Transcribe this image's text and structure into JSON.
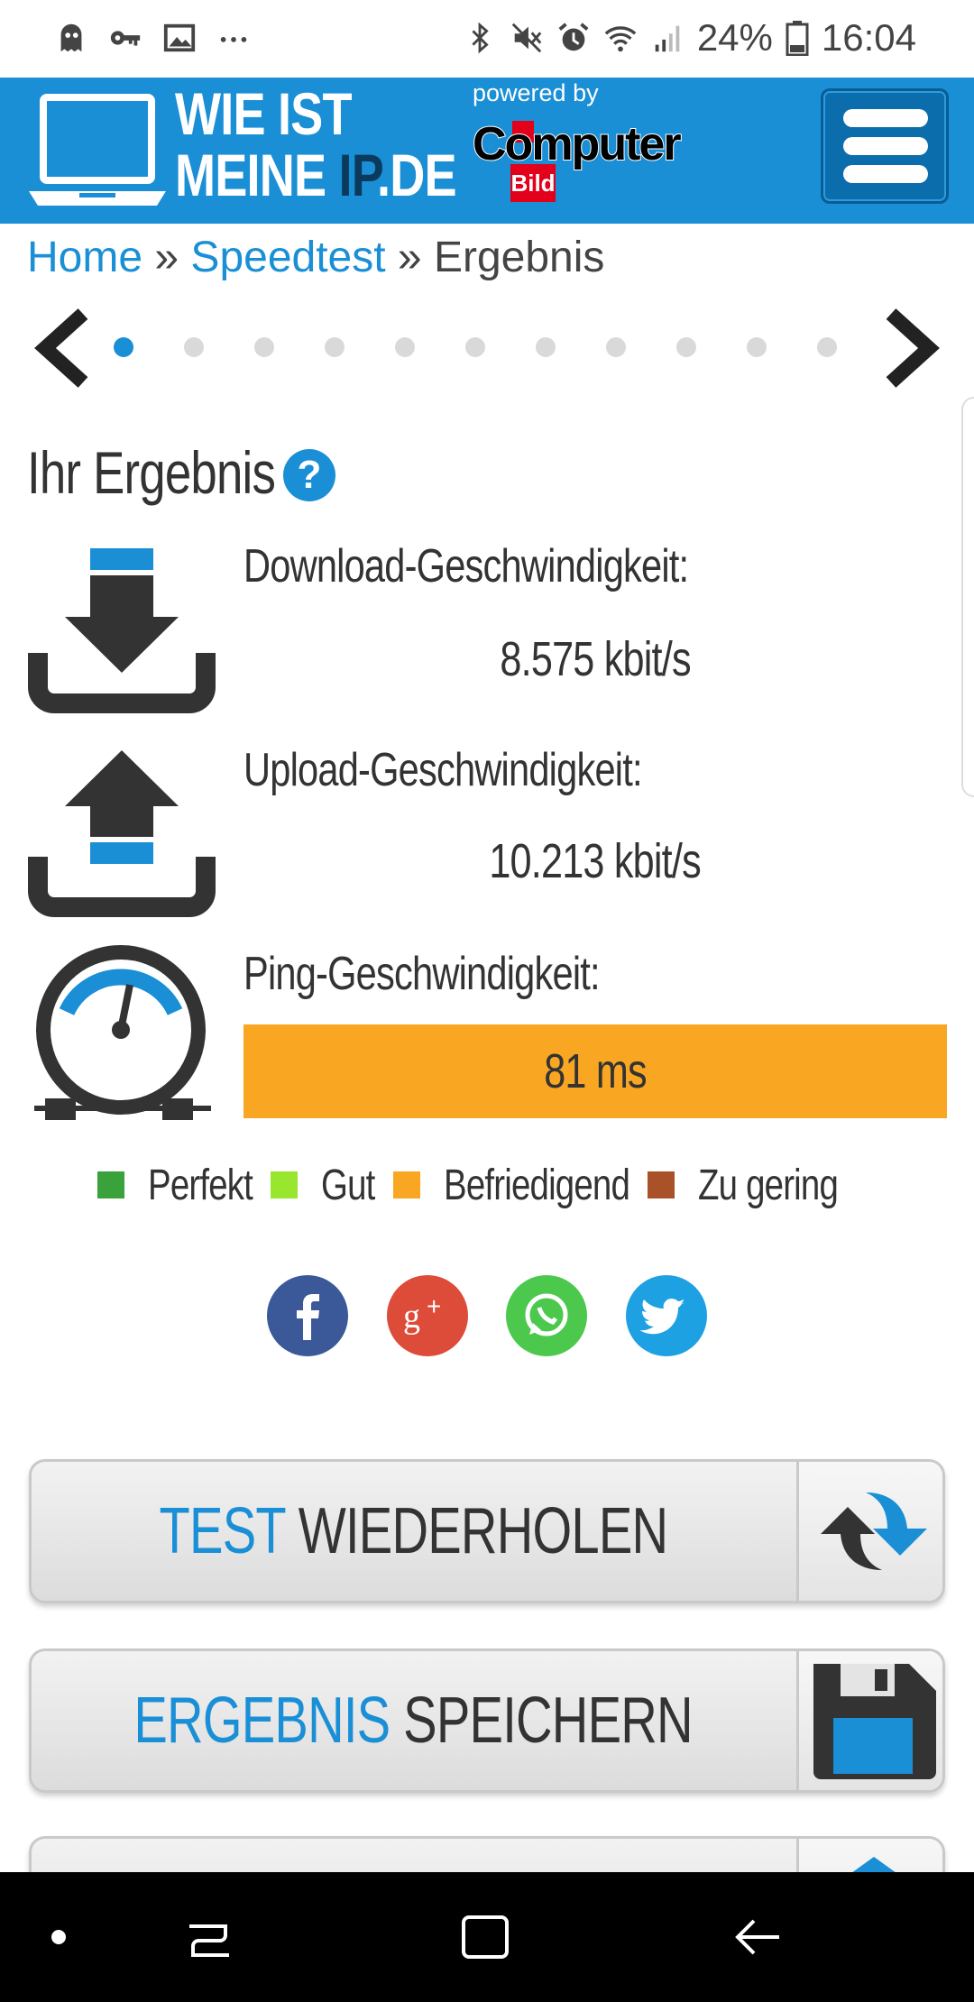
{
  "status_bar": {
    "left_icons": [
      "ghost-icon",
      "key-icon",
      "image-icon",
      "more-icon"
    ],
    "right_icons": [
      "bluetooth-icon",
      "mute-icon",
      "alarm-icon",
      "wifi-icon",
      "signal-icon"
    ],
    "battery": "24%",
    "time": "16:04"
  },
  "header": {
    "logo_line1": "WIE IST",
    "logo_line2_a": "MEINE ",
    "logo_line2_b": "IP",
    "logo_line2_c": ".DE",
    "powered_by": "powered by",
    "partner_name": "Computer",
    "partner_sub": "Bild"
  },
  "breadcrumb": {
    "home": "Home",
    "sep1": " » ",
    "speedtest": "Speedtest",
    "sep2": " » ",
    "current": "Ergebnis"
  },
  "carousel": {
    "dot_count": 11,
    "active_index": 0
  },
  "result": {
    "title": "Ihr Ergebnis",
    "help": "?",
    "download_label": "Download-Geschwindigkeit:",
    "download_value": "8.575 kbit/s",
    "upload_label": "Upload-Geschwindigkeit:",
    "upload_value": "10.213 kbit/s",
    "ping_label": "Ping-Geschwindigkeit:",
    "ping_value": "81 ms"
  },
  "legend": [
    {
      "label": "Perfekt",
      "color": "#3aa23a"
    },
    {
      "label": "Gut",
      "color": "#99e62e"
    },
    {
      "label": "Befriedigend",
      "color": "#f9a623"
    },
    {
      "label": "Zu gering",
      "color": "#a9522a"
    }
  ],
  "colors": {
    "brand_blue": "#1a8fd6",
    "ping_bar": "#f9a623",
    "facebook": "#3b5998",
    "googleplus": "#dd4b39",
    "whatsapp": "#4cc94c",
    "twitter": "#1da1e2"
  },
  "buttons": {
    "repeat_hl": "TEST",
    "repeat_rest": " WIEDERHOLEN",
    "save_hl": "ERGEBNIS",
    "save_rest": " SPEICHERN"
  }
}
